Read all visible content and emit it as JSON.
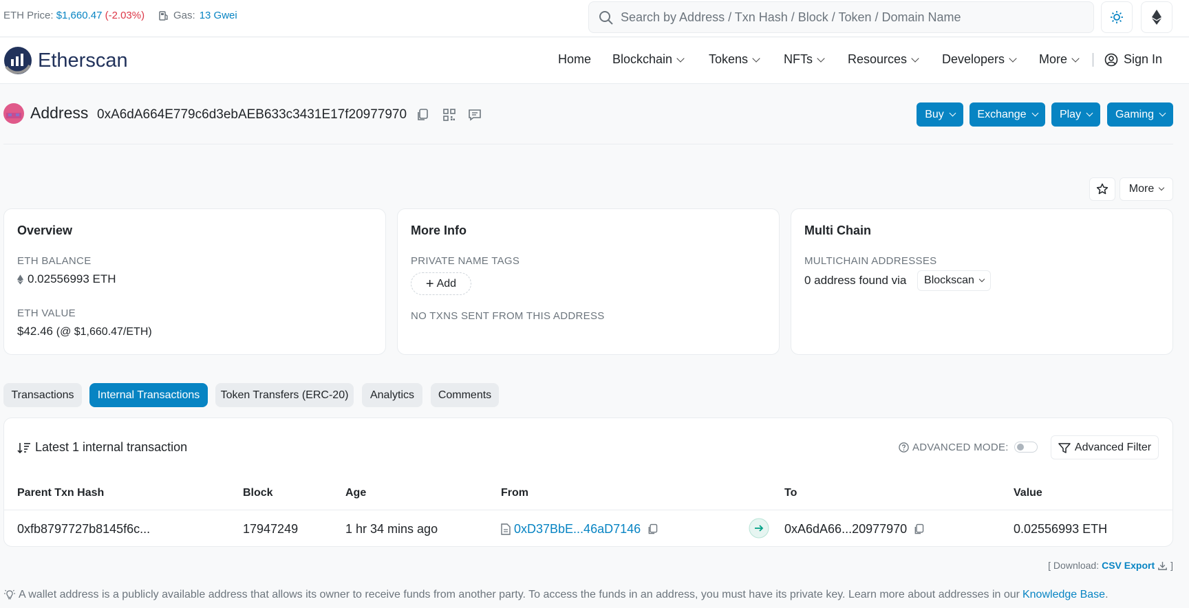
{
  "topbar": {
    "eth_price_label": "ETH Price:",
    "eth_price_value": "$1,660.47",
    "eth_price_change": "(-2.03%)",
    "gas_label": "Gas:",
    "gas_value": "13 Gwei",
    "search_placeholder": "Search by Address / Txn Hash / Block / Token / Domain Name"
  },
  "nav": {
    "logo_text": "Etherscan",
    "items": [
      "Home",
      "Blockchain",
      "Tokens",
      "NFTs",
      "Resources",
      "Developers",
      "More"
    ],
    "sign_in": "Sign In"
  },
  "address": {
    "title": "Address",
    "hash": "0xA6dA664E779c6d3ebAEB633c3431E17f20977970",
    "buttons": [
      "Buy",
      "Exchange",
      "Play",
      "Gaming"
    ],
    "more_label": "More"
  },
  "overview": {
    "title": "Overview",
    "balance_label": "ETH BALANCE",
    "balance_value": "0.02556993 ETH",
    "value_label": "ETH VALUE",
    "value_amount": "$42.46",
    "value_rate": "(@ $1,660.47/ETH)"
  },
  "more_info": {
    "title": "More Info",
    "tags_label": "PRIVATE NAME TAGS",
    "add_label": "Add",
    "no_txns": "NO TXNS SENT FROM THIS ADDRESS"
  },
  "multi_chain": {
    "title": "Multi Chain",
    "label": "MULTICHAIN ADDRESSES",
    "found_text": "0 address found via",
    "dropdown": "Blockscan"
  },
  "tabs": [
    "Transactions",
    "Internal Transactions",
    "Token Transfers (ERC-20)",
    "Analytics",
    "Comments"
  ],
  "active_tab": "Internal Transactions",
  "table": {
    "summary": "Latest 1 internal transaction",
    "advanced_mode_label": "ADVANCED MODE:",
    "advanced_filter": "Advanced Filter",
    "columns": [
      "Parent Txn Hash",
      "Block",
      "Age",
      "From",
      "To",
      "Value"
    ],
    "rows": [
      {
        "parent_hash": "0xfb8797727b8145f6c...",
        "block": "17947249",
        "age": "1 hr 34 mins ago",
        "from": "0xD37BbE...46aD7146",
        "to": "0xA6dA66...20977970",
        "value": "0.02556993 ETH"
      }
    ]
  },
  "download": {
    "open": "[ Download:",
    "link": "CSV Export",
    "close": "]"
  },
  "footnote": {
    "text": "A wallet address is a publicly available address that allows its owner to receive funds from another party. To access the funds in an address, you must have its private key. Learn more about addresses in our",
    "link": "Knowledge Base",
    "end": "."
  },
  "colors": {
    "accent": "#0784c3",
    "negative": "#dc3545",
    "text": "#212529",
    "muted": "#6c757d"
  }
}
